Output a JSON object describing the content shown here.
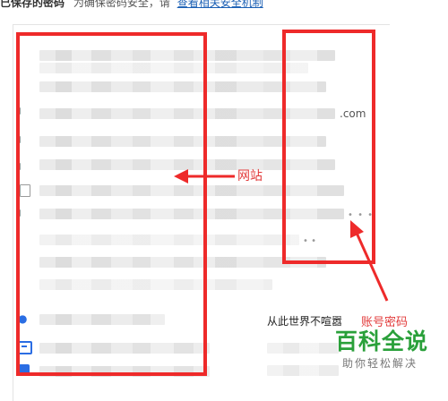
{
  "header": {
    "title": "已保存的密码",
    "subtitle": "为确保密码安全，请",
    "link": "查看相关安全机制"
  },
  "rows": {
    "domain_suffix": ".com",
    "masked_1": "• • •",
    "masked_2": "• •",
    "password_text": "从此世界不喧嚣"
  },
  "annotations": {
    "site_label": "网站",
    "account_label": "账号密码",
    "color": "#ee2a2a"
  },
  "watermark": {
    "logo": "百科全说",
    "tagline": "助你轻松解决"
  },
  "icons": [
    "file-icon",
    "paw-icon",
    "calendar-icon",
    "square-app-icon"
  ]
}
